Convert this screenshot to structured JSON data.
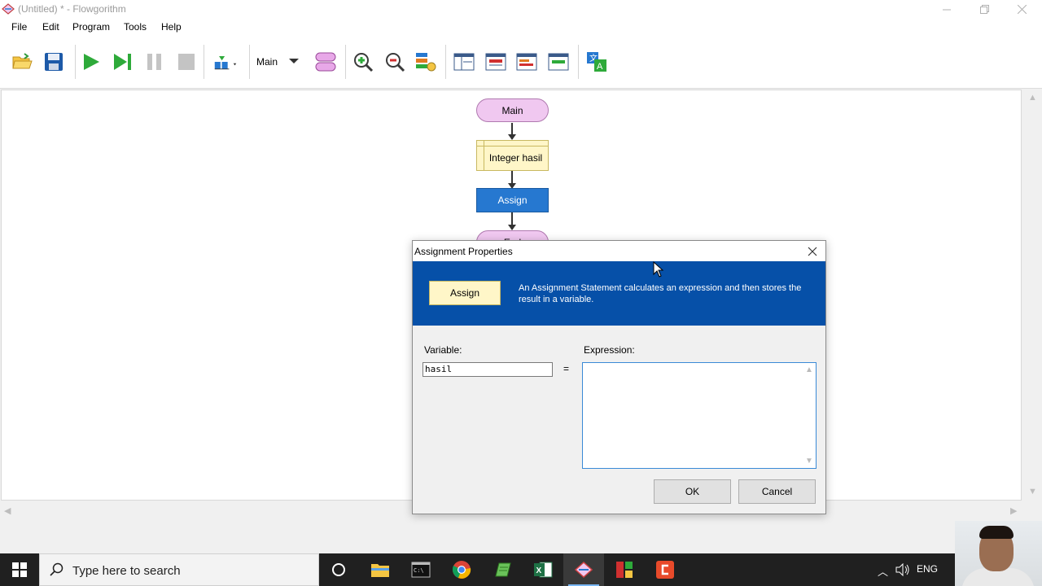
{
  "window": {
    "title": "(Untitled) * - Flowgorithm",
    "controls": [
      "minimize",
      "restore",
      "close"
    ]
  },
  "menu": [
    "File",
    "Edit",
    "Program",
    "Tools",
    "Help"
  ],
  "toolbar": {
    "function_selector": "Main",
    "buttons": [
      "open-icon",
      "save-icon",
      "run-icon",
      "step-icon",
      "pause-icon",
      "stop-icon",
      "speed-icon",
      "function-shape-icon",
      "zoom-in-icon",
      "zoom-out-icon",
      "layout-icon",
      "variable-watch-icon",
      "console-icon",
      "chart-icon",
      "source-code-icon",
      "translate-icon"
    ]
  },
  "flowchart": {
    "start": "Main",
    "declare": "Integer hasil",
    "assign": "Assign",
    "end": "End"
  },
  "dialog": {
    "title": "Assignment Properties",
    "shape_label": "Assign",
    "description": "An Assignment Statement calculates an expression and then stores the result in a variable.",
    "variable_label": "Variable:",
    "variable_value": "hasil",
    "equals": "=",
    "expression_label": "Expression:",
    "expression_value": "",
    "ok": "OK",
    "cancel": "Cancel"
  },
  "taskbar": {
    "search_placeholder": "Type here to search",
    "language": "ENG",
    "apps": [
      "cortana-icon",
      "file-explorer-icon",
      "terminal-icon",
      "chrome-icon",
      "notepad-icon",
      "excel-icon",
      "flowgorithm-icon",
      "app-icon",
      "camtasia-icon"
    ]
  }
}
